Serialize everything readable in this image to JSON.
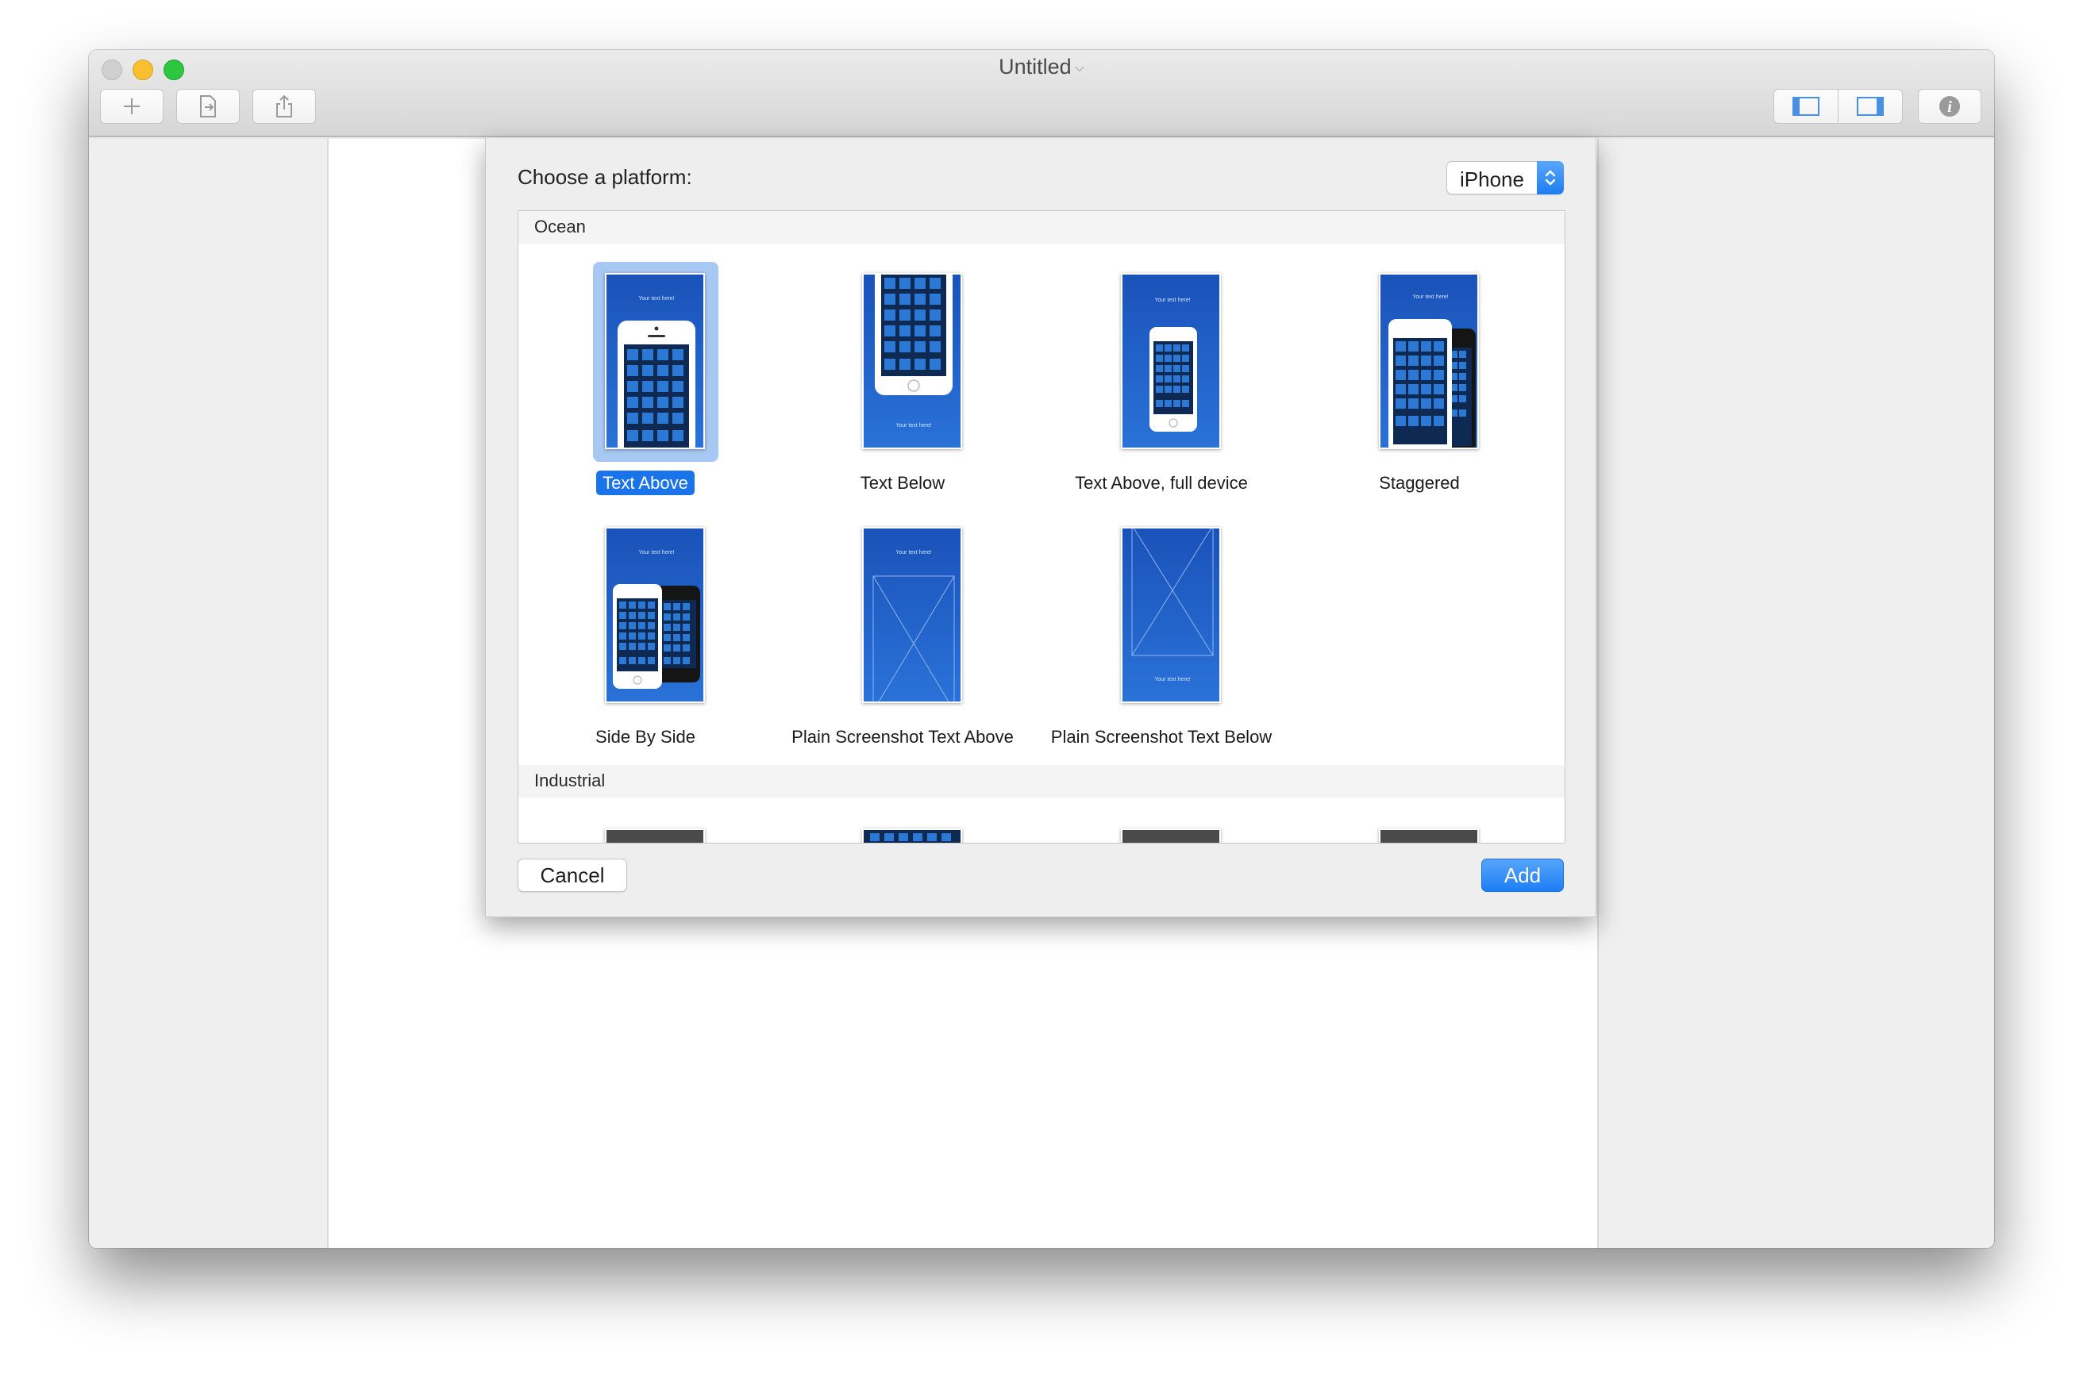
{
  "window": {
    "title": "Untitled"
  },
  "toolbar": {
    "left_buttons": [
      "plus-icon",
      "export-document-icon",
      "share-icon"
    ],
    "right_buttons": [
      "left-sidebar-toggle-icon",
      "right-sidebar-toggle-icon",
      "info-icon"
    ]
  },
  "sheet": {
    "title": "Choose a platform:",
    "platform": {
      "selected": "iPhone"
    },
    "sections": [
      {
        "name": "Ocean",
        "templates": [
          {
            "label": "Text Above",
            "selected": true,
            "caption": "Your text here!"
          },
          {
            "label": "Text Below",
            "selected": false,
            "caption": "Your text here!"
          },
          {
            "label": "Text Above, full device",
            "selected": false,
            "caption": "Your text here!"
          },
          {
            "label": "Staggered",
            "selected": false,
            "caption": "Your text here!"
          },
          {
            "label": "Side By Side",
            "selected": false,
            "caption": "Your text here!"
          },
          {
            "label": "Plain Screenshot Text Above",
            "selected": false,
            "caption": "Your text here!"
          },
          {
            "label": "Plain Screenshot Text Below",
            "selected": false,
            "caption": "Your text here!"
          }
        ]
      },
      {
        "name": "Industrial",
        "templates": []
      }
    ],
    "cancel_label": "Cancel",
    "add_label": "Add"
  },
  "colors": {
    "accent": "#1a73e8",
    "thumb_blue": "#1f5fc6",
    "selection": "#a7c8f2"
  }
}
